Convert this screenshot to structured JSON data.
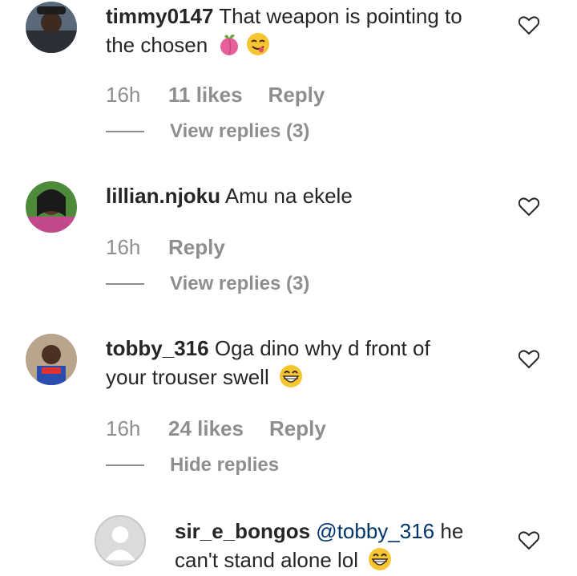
{
  "comments": [
    {
      "username": "timmy0147",
      "text_line1": "That weapon is pointing to",
      "text_line2": "the chosen",
      "emojis": [
        "peach-icon",
        "smiling-face-tongue-icon"
      ],
      "time": "16h",
      "likes": "11 likes",
      "reply": "Reply",
      "replies_toggle": "View replies (3)"
    },
    {
      "username": "lillian.njoku",
      "text_line1": "Amu na ekele",
      "time": "16h",
      "reply": "Reply",
      "replies_toggle": "View replies (3)"
    },
    {
      "username": "tobby_316",
      "text_line1": "Oga dino why d front of",
      "text_line2": "your trouser swell",
      "emojis": [
        "grinning-face-icon"
      ],
      "time": "16h",
      "likes": "24 likes",
      "reply": "Reply",
      "replies_toggle": "Hide replies"
    },
    {
      "username": "sir_e_bongos",
      "mention": "@tobby_316",
      "text_line1_rest": "he",
      "text_line2": "can't stand alone lol",
      "emojis": [
        "grinning-face-icon"
      ]
    }
  ],
  "colors": {
    "text": "#262626",
    "secondary": "#8e8e8e",
    "mention": "#003569"
  }
}
